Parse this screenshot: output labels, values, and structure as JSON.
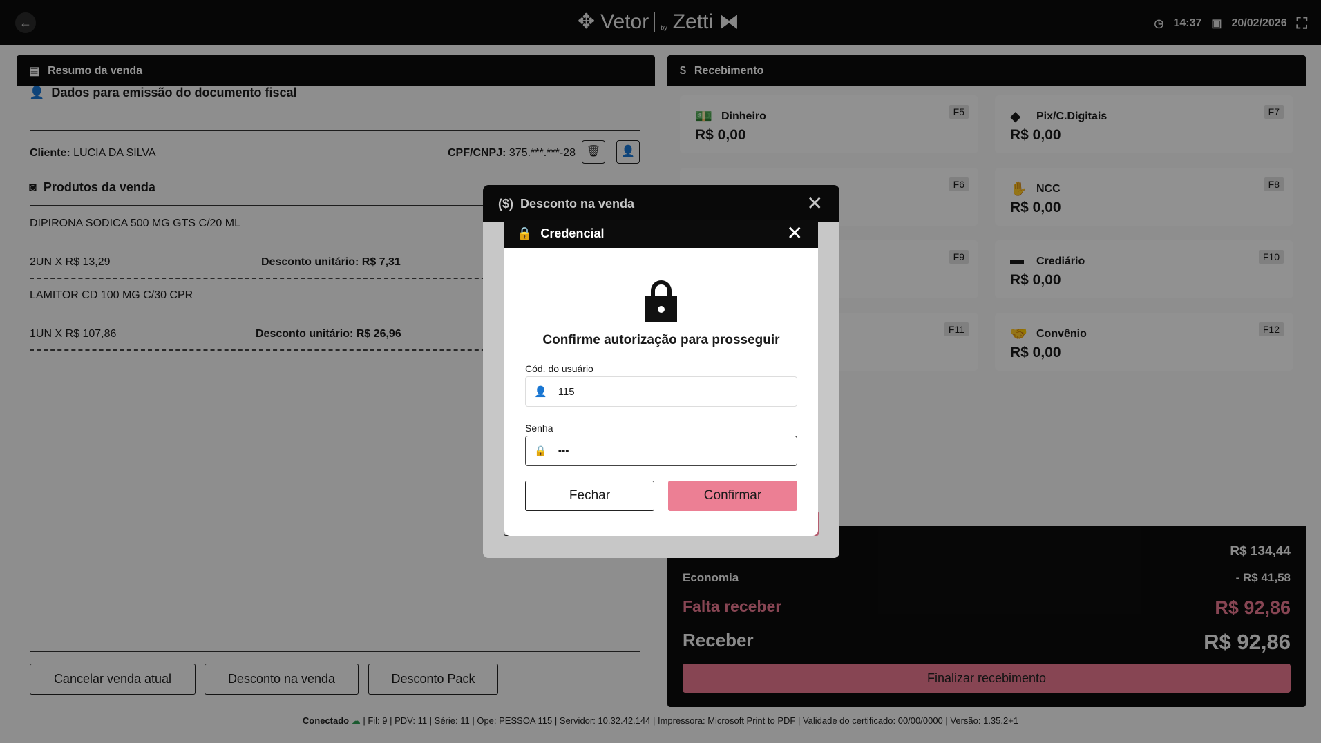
{
  "topbar": {
    "brand": "Vetor",
    "by": "by",
    "brand2": "Zetti",
    "time": "14:37",
    "date": "20/02/2026"
  },
  "left": {
    "title": "Resumo da venda",
    "fiscal_title": "Dados para emissão do documento fiscal",
    "client_label": "Cliente:",
    "client": "LUCIA DA SILVA",
    "cpf_label": "CPF/CNPJ:",
    "cpf": "375.***.***-28",
    "products_title": "Produtos da venda",
    "products": [
      {
        "name": "DIPIRONA SODICA 500 MG GTS C/20 ML",
        "qty": "2UN X R$ 13,29",
        "discount": "Desconto unitário: R$ 7,31"
      },
      {
        "name": "LAMITOR CD 100 MG C/30 CPR",
        "qty": "1UN X R$ 107,86",
        "discount": "Desconto unitário: R$ 26,96"
      }
    ],
    "buttons": {
      "cancel": "Cancelar venda atual",
      "discount": "Desconto na venda",
      "pack": "Desconto Pack"
    }
  },
  "right": {
    "title": "Recebimento",
    "cards": [
      {
        "label": "Dinheiro",
        "value": "R$  0,00",
        "key": "F5"
      },
      {
        "label": "Pix/C.Digitais",
        "value": "R$  0,00",
        "key": "F7"
      },
      {
        "label": "",
        "value": "",
        "key": "F6"
      },
      {
        "label": "NCC",
        "value": "R$  0,00",
        "key": "F8"
      },
      {
        "label": "",
        "value": "",
        "key": "F9"
      },
      {
        "label": "Crediário",
        "value": "R$  0,00",
        "key": "F10"
      },
      {
        "label": "",
        "value": "",
        "key": "F11"
      },
      {
        "label": "Convênio",
        "value": "R$  0,00",
        "key": "F12"
      }
    ],
    "summary": {
      "total": "R$ 134,44",
      "economy_label": "Economia",
      "economy": "- R$ 41,58",
      "missing_label": "Falta receber",
      "missing": "R$ 92,86",
      "receive_label": "Receber",
      "receive": "R$ 92,86",
      "finalize": "Finalizar recebimento"
    }
  },
  "footer": {
    "status": "Conectado",
    "info": "| Fil: 9 | PDV: 11 | Série: 11 | Ope: PESSOA 115 | Servidor: 10.32.42.144 | Impressora: Microsoft Print to PDF | Validade do certificado: 00/00/0000 | Versão: 1.35.2+1"
  },
  "discount_modal": {
    "title": "Desconto na venda"
  },
  "credential_modal": {
    "title": "Credencial",
    "heading": "Confirme autorização para prosseguir",
    "user_label": "Cód. do usuário",
    "user_value": "115",
    "password_label": "Senha",
    "password_value": "•••",
    "close": "Fechar",
    "confirm": "Confirmar"
  },
  "colors": {
    "accent": "#e8788f",
    "dark": "#0c0c0c"
  }
}
